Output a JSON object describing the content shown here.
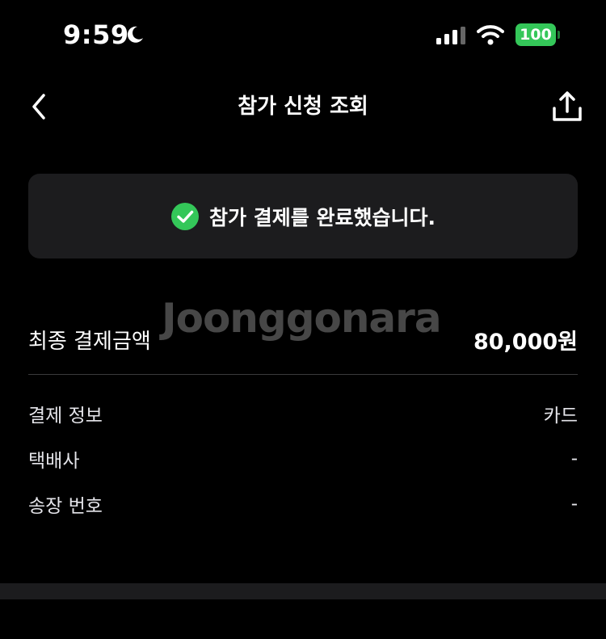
{
  "status_bar": {
    "time": "9:59",
    "battery": "100",
    "icons": [
      "moon-icon",
      "cellular-signal-icon",
      "wifi-icon",
      "battery-icon"
    ]
  },
  "nav": {
    "title": "참가 신청 조회",
    "back_icon": "chevron-left-icon",
    "share_icon": "share-icon"
  },
  "banner": {
    "icon": "check-circle-icon",
    "message": "참가 결제를 완료했습니다."
  },
  "total": {
    "label": "최종 결제금액",
    "value": "80,000원"
  },
  "info": [
    {
      "label": "결제 정보",
      "value": "카드"
    },
    {
      "label": "택배사",
      "value": "-"
    },
    {
      "label": "송장 번호",
      "value": "-"
    }
  ],
  "watermark": "Joonggonara",
  "colors": {
    "background": "#000000",
    "card": "#1c1c1e",
    "success": "#34c759",
    "text": "#ffffff",
    "divider": "#3a3a3c"
  }
}
